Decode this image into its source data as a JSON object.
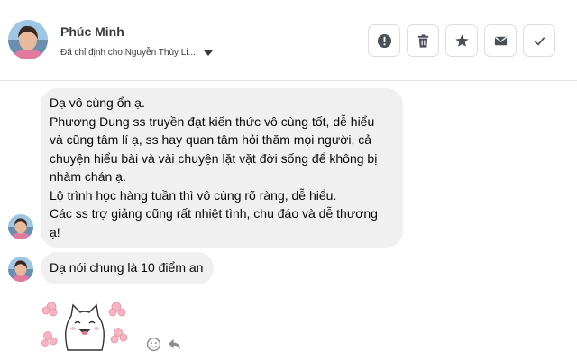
{
  "header": {
    "contact_name": "Phúc Minh",
    "assigned_text": "Đã chỉ định cho Nguyễn Thùy Li...",
    "actions": [
      {
        "icon": "alert-icon",
        "name": "mark-spam-button"
      },
      {
        "icon": "trash-icon",
        "name": "delete-button"
      },
      {
        "icon": "star-icon",
        "name": "star-button"
      },
      {
        "icon": "mail-icon",
        "name": "mark-unread-button"
      },
      {
        "icon": "check-icon",
        "name": "mark-done-button"
      }
    ]
  },
  "messages": [
    {
      "lines": [
        "Dạ vô cùng ổn ạ.",
        "Phương Dung ss truyền đạt kiến thức vô cùng tốt, dễ hiểu",
        "và cũng tâm lí ạ, ss hay quan tâm hỏi thăm mọi người, cả",
        "chuyện hiểu bài và vài chuyện lặt vặt đời sống để không bị",
        "nhàm chán ạ.",
        "Lộ trình học hàng tuần thì vô cùng rõ ràng, dễ hiểu.",
        "Các ss trợ giảng cũng rất nhiệt tình, chu đáo và dễ thương",
        "ạ!"
      ]
    },
    {
      "lines": [
        "Dạ nói chung là 10 điểm an"
      ]
    }
  ],
  "icons": {
    "sticker": "cat-sticker-icon",
    "react": "smiley-icon",
    "reply": "reply-icon"
  },
  "colors": {
    "bubble": "#f0f0f0",
    "border": "#dcdde0",
    "icon": "#4b4f56"
  }
}
